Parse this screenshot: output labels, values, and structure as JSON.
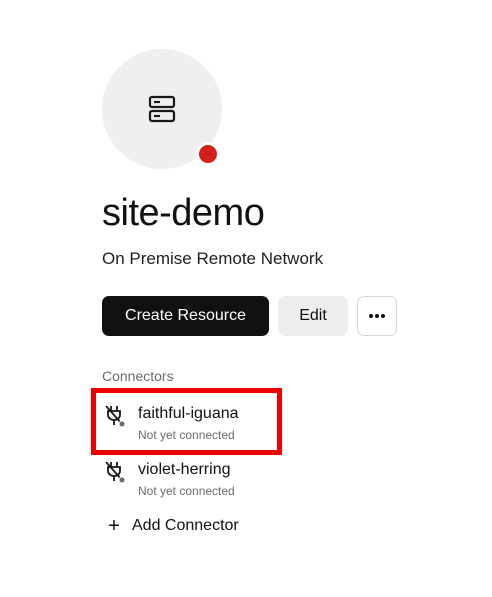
{
  "network": {
    "name": "site-demo",
    "type": "On Premise Remote Network",
    "status_color": "#d1211a",
    "icon": "server-icon"
  },
  "actions": {
    "create_resource": "Create Resource",
    "edit": "Edit",
    "more": "more-horizontal-icon"
  },
  "connectors": {
    "section_label": "Connectors",
    "items": [
      {
        "name": "faithful-iguana",
        "status": "Not yet connected",
        "icon": "plug-icon"
      },
      {
        "name": "violet-herring",
        "status": "Not yet connected",
        "icon": "plug-icon"
      }
    ],
    "add_label": "Add Connector"
  },
  "colors": {
    "primary_button": "#111111",
    "highlight": "#ee0000"
  }
}
